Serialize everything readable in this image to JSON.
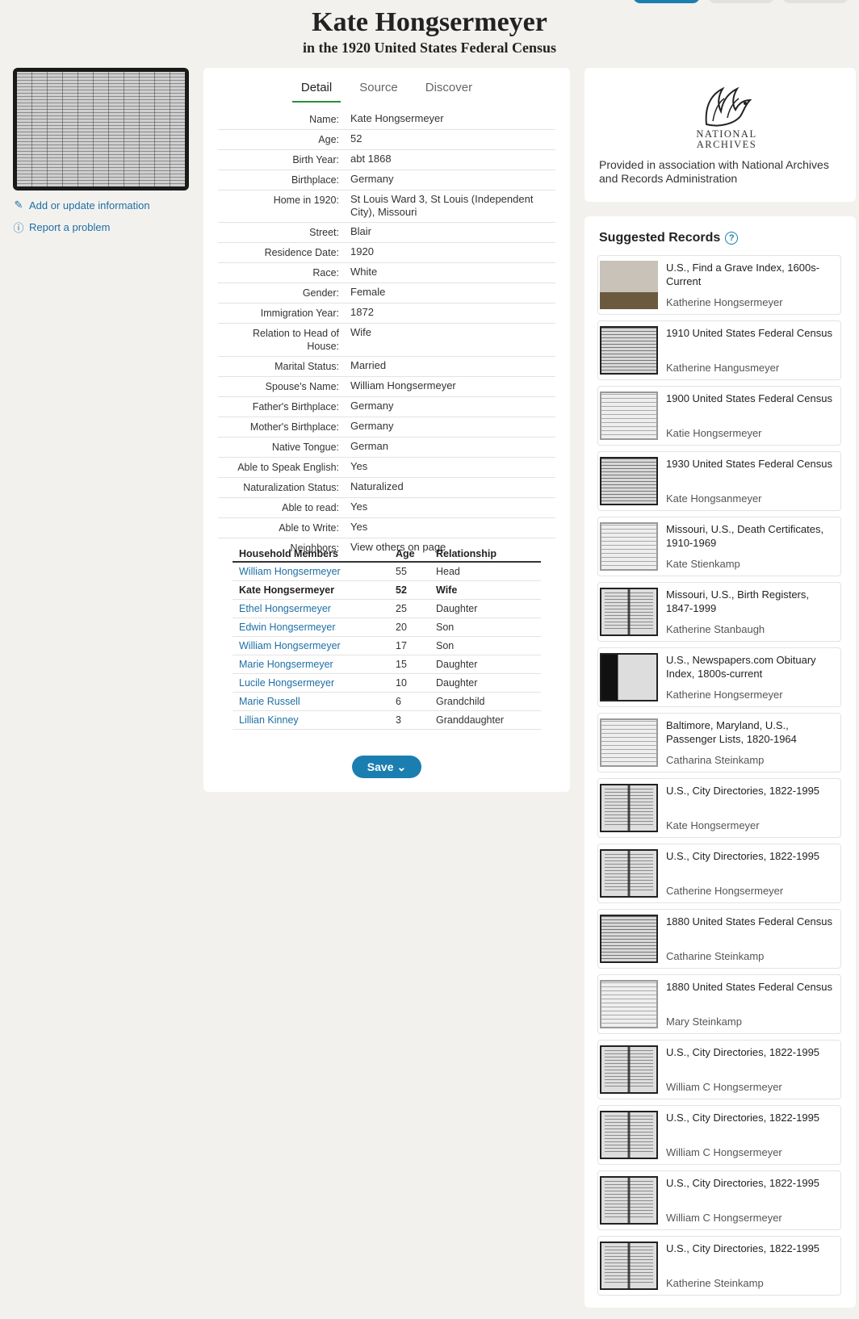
{
  "header": {
    "title": "Kate Hongsermeyer",
    "subtitle": "in the 1920 United States Federal Census"
  },
  "sidebar": {
    "add_update_label": "Add or update information",
    "report_label": "Report a problem"
  },
  "tabs": [
    "Detail",
    "Source",
    "Discover"
  ],
  "fields": [
    {
      "label": "Name:",
      "value": "Kate Hongsermeyer"
    },
    {
      "label": "Age:",
      "value": "52"
    },
    {
      "label": "Birth Year:",
      "value": "abt 1868"
    },
    {
      "label": "Birthplace:",
      "value": "Germany"
    },
    {
      "label": "Home in 1920:",
      "value": "St Louis Ward 3, St Louis (Independent City), Missouri"
    },
    {
      "label": "Street:",
      "value": "Blair"
    },
    {
      "label": "Residence Date:",
      "value": "1920"
    },
    {
      "label": "Race:",
      "value": "White"
    },
    {
      "label": "Gender:",
      "value": "Female"
    },
    {
      "label": "Immigration Year:",
      "value": "1872"
    },
    {
      "label": "Relation to Head of House:",
      "value": "Wife"
    },
    {
      "label": "Marital Status:",
      "value": "Married"
    },
    {
      "label": "Spouse's Name:",
      "value": "William Hongsermeyer"
    },
    {
      "label": "Father's Birthplace:",
      "value": "Germany"
    },
    {
      "label": "Mother's Birthplace:",
      "value": "Germany"
    },
    {
      "label": "Native Tongue:",
      "value": "German"
    },
    {
      "label": "Able to Speak English:",
      "value": "Yes"
    },
    {
      "label": "Naturalization Status:",
      "value": "Naturalized"
    },
    {
      "label": "Able to read:",
      "value": "Yes"
    },
    {
      "label": "Able to Write:",
      "value": "Yes"
    },
    {
      "label": "Neighbors:",
      "value": "View others on page"
    }
  ],
  "household": {
    "headers": [
      "Household Members",
      "Age",
      "Relationship"
    ],
    "rows": [
      {
        "name": "William Hongsermeyer",
        "age": "55",
        "rel": "Head"
      },
      {
        "name": "Kate Hongsermeyer",
        "age": "52",
        "rel": "Wife"
      },
      {
        "name": "Ethel Hongsermeyer",
        "age": "25",
        "rel": "Daughter"
      },
      {
        "name": "Edwin Hongsermeyer",
        "age": "20",
        "rel": "Son"
      },
      {
        "name": "William Hongsermeyer",
        "age": "17",
        "rel": "Son"
      },
      {
        "name": "Marie Hongsermeyer",
        "age": "15",
        "rel": "Daughter"
      },
      {
        "name": "Lucile Hongsermeyer",
        "age": "10",
        "rel": "Daughter"
      },
      {
        "name": "Marie Russell",
        "age": "6",
        "rel": "Grandchild"
      },
      {
        "name": "Lillian Kinney",
        "age": "3",
        "rel": "Granddaughter"
      }
    ]
  },
  "save_label": "Save",
  "archives": {
    "logo_line1": "NATIONAL",
    "logo_line2": "ARCHIVES",
    "description": "Provided in association with National Archives and Records Administration"
  },
  "suggested": {
    "title": "Suggested Records",
    "records": [
      {
        "title": "U.S., Find a Grave Index, 1600s-Current",
        "name": "Katherine Hongsermeyer",
        "thumb": "grave"
      },
      {
        "title": "1910 United States Federal Census",
        "name": "Katherine Hangusmeyer",
        "thumb": "census"
      },
      {
        "title": "1900 United States Federal Census",
        "name": "Katie Hongsermeyer",
        "thumb": "light"
      },
      {
        "title": "1930 United States Federal Census",
        "name": "Kate Hongsanmeyer",
        "thumb": "census"
      },
      {
        "title": "Missouri, U.S., Death Certificates, 1910-1969",
        "name": "Kate Stienkamp",
        "thumb": "light"
      },
      {
        "title": "Missouri, U.S., Birth Registers, 1847-1999",
        "name": "Katherine Stanbaugh",
        "thumb": "book"
      },
      {
        "title": "U.S., Newspapers.com Obituary Index, 1800s-current",
        "name": "Katherine Hongsermeyer",
        "thumb": "news"
      },
      {
        "title": "Baltimore, Maryland, U.S., Passenger Lists, 1820-1964",
        "name": "Catharina Steinkamp",
        "thumb": "light"
      },
      {
        "title": "U.S., City Directories, 1822-1995",
        "name": "Kate Hongsermeyer",
        "thumb": "book"
      },
      {
        "title": "U.S., City Directories, 1822-1995",
        "name": "Catherine Hongsermeyer",
        "thumb": "book"
      },
      {
        "title": "1880 United States Federal Census",
        "name": "Catharine Steinkamp",
        "thumb": "census"
      },
      {
        "title": "1880 United States Federal Census",
        "name": "Mary Steinkamp",
        "thumb": "light"
      },
      {
        "title": "U.S., City Directories, 1822-1995",
        "name": "William C Hongsermeyer",
        "thumb": "book"
      },
      {
        "title": "U.S., City Directories, 1822-1995",
        "name": "William C Hongsermeyer",
        "thumb": "book"
      },
      {
        "title": "U.S., City Directories, 1822-1995",
        "name": "William C Hongsermeyer",
        "thumb": "book"
      },
      {
        "title": "U.S., City Directories, 1822-1995",
        "name": "Katherine Steinkamp",
        "thumb": "book"
      }
    ]
  }
}
